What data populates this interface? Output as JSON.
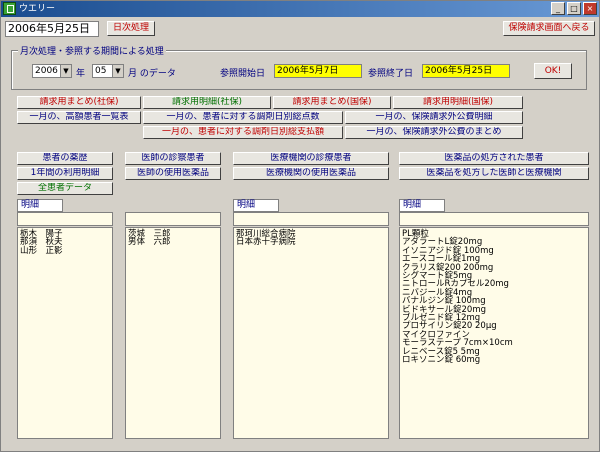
{
  "window": {
    "title": "ウエリー",
    "minimize": "_",
    "maximize": "□",
    "close": "×"
  },
  "header": {
    "date": "2006年5月25日",
    "daily_button": "日次処理",
    "back_button": "保険請求画面へ戻る"
  },
  "monthly": {
    "title": "月次処理・参照する期間による処理",
    "year": "2006",
    "year_label": "年",
    "month": "05",
    "month_label": "月 のデータ",
    "start_label": "参照開始日",
    "start_date": "2006年5月7日",
    "end_label": "参照終了日",
    "end_date": "2006年5月25日",
    "ok_button": "OK!"
  },
  "grid_buttons": {
    "row1": [
      "請求用まとめ(社保)",
      "請求用明細(社保)",
      "請求用まとめ(国保)",
      "請求用明細(国保)"
    ],
    "row2": [
      "一月の、高額患者一覧表",
      "一月の、患者に対する調剤日別総点数",
      "一月の、保険請求外公費明細"
    ],
    "row3": [
      "一月の、患者に対する調剤日別総支払額",
      "一月の、保険請求外公費のまとめ"
    ]
  },
  "category_buttons": {
    "col1": [
      "患者の薬歴",
      "1年間の利用明細",
      "全患者データ"
    ],
    "col2": [
      "医師の診察患者",
      "医師の使用医薬品"
    ],
    "col3": [
      "医療機関の診療患者",
      "医療機関の使用医薬品"
    ],
    "col4": [
      "医薬品の処方された患者",
      "医薬品を処方した医師と医療機関"
    ]
  },
  "lists": {
    "detail_label": "明細",
    "patients": [
      "栃木　陽子",
      "那須　秋夫",
      "山形　正影"
    ],
    "doctors": [
      "茨城　三郎",
      "男体　六郎"
    ],
    "institutions": [
      "那珂川総合病院",
      "日本赤十字病院"
    ],
    "drugs": [
      "PL顆粒",
      "アダラートL錠20mg",
      "イソニアジド錠 100mg",
      "エースコール錠1mg",
      "クラリス錠200 200mg",
      "シグマート錠5mg",
      "ニトロールRカプセル20mg",
      "ニバジール錠4mg",
      "バナルジン錠 100mg",
      "ビドキサール錠20mg",
      "ブルゼニド錠 12mg",
      "プロサイリン錠20 20μg",
      "マイクロファイン",
      "モーラステープ 7cm×10cm",
      "レニベース錠5 5mg",
      "ロキソニン錠 60mg"
    ]
  }
}
